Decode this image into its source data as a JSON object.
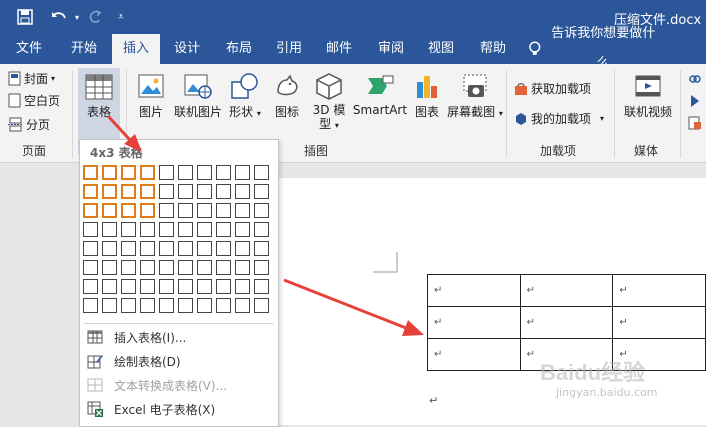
{
  "window": {
    "doc_title": "压缩文件.docx",
    "accent": "#2b579a",
    "quick_access": [
      "save-icon",
      "undo-icon",
      "redo-icon",
      "customize-icon"
    ]
  },
  "tabs": [
    {
      "label": "文件",
      "active": false
    },
    {
      "label": "开始",
      "active": false
    },
    {
      "label": "插入",
      "active": true
    },
    {
      "label": "设计",
      "active": false
    },
    {
      "label": "布局",
      "active": false
    },
    {
      "label": "引用",
      "active": false
    },
    {
      "label": "邮件",
      "active": false
    },
    {
      "label": "审阅",
      "active": false
    },
    {
      "label": "视图",
      "active": false
    },
    {
      "label": "帮助",
      "active": false
    }
  ],
  "tell_me": "告诉我你想要做什么",
  "ribbon": {
    "pages": {
      "cover": "封面",
      "blank": "空白页",
      "break": "分页",
      "group": "页面"
    },
    "table": {
      "label": "表格"
    },
    "illustrations": {
      "picture": "图片",
      "online_picture": "联机图片",
      "shapes": "形状",
      "icons": "图标",
      "model_3d_line1": "3D 模",
      "model_3d_line2": "型",
      "smartart": "SmartArt",
      "chart": "图表",
      "screenshot": "屏幕截图",
      "group": "插图"
    },
    "addins": {
      "get": "获取加载项",
      "mine": "我的加载项",
      "group": "加载项"
    },
    "media": {
      "online_video": "联机视频",
      "group": "媒体"
    }
  },
  "table_dropdown": {
    "title": "4x3 表格",
    "grid_cols": 10,
    "grid_rows": 8,
    "sel_cols": 4,
    "sel_rows": 3,
    "highlight_color": "#e07b1a",
    "items": [
      {
        "label": "插入表格(I)...",
        "icon": "insert-table-icon",
        "disabled": false
      },
      {
        "label": "绘制表格(D)",
        "icon": "draw-table-icon",
        "disabled": false
      },
      {
        "label": "文本转换成表格(V)...",
        "icon": "convert-text-icon",
        "disabled": true
      },
      {
        "label": "Excel 电子表格(X)",
        "icon": "excel-sheet-icon",
        "disabled": false
      }
    ]
  },
  "document": {
    "cell_mark": "↵",
    "para_mark": "↵"
  },
  "annotations": {
    "arrow_color": "#e8413c"
  },
  "watermark": {
    "brand": "Baidu经验",
    "url": "jingyan.baidu.com"
  }
}
